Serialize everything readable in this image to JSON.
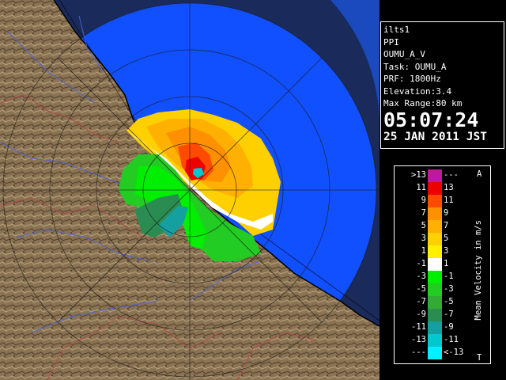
{
  "info": {
    "site": "ilts1",
    "scan": "PPI",
    "product": "OUMU_A_V",
    "task": "Task: OUMU_A",
    "prf": "PRF: 1800Hz",
    "elevation": "Elevation:3.4",
    "max_range": "Max Range:80 km",
    "time": "05:07:24",
    "date": "25 JAN 2011 JST"
  },
  "legend": {
    "title": "Mean Velocity in m/s",
    "top_letter": "A",
    "bottom_letter": "T",
    "rows": [
      {
        "lo": ">13",
        "hi": "---",
        "color": "#c0189a"
      },
      {
        "lo": "11",
        "hi": "13",
        "color": "#ee0000"
      },
      {
        "lo": "9",
        "hi": "11",
        "color": "#ff4a00"
      },
      {
        "lo": "7",
        "hi": "9",
        "color": "#ff9000"
      },
      {
        "lo": "5",
        "hi": "7",
        "color": "#ffb000"
      },
      {
        "lo": "3",
        "hi": "5",
        "color": "#ffd000"
      },
      {
        "lo": "1",
        "hi": "3",
        "color": "#fff000"
      },
      {
        "lo": "-1",
        "hi": "1",
        "color": "#ffffff"
      },
      {
        "lo": "-3",
        "hi": "-1",
        "color": "#00ee00"
      },
      {
        "lo": "-5",
        "hi": "-3",
        "color": "#22cc22"
      },
      {
        "lo": "-7",
        "hi": "-5",
        "color": "#33aa33"
      },
      {
        "lo": "-9",
        "hi": "-7",
        "color": "#2a8c50"
      },
      {
        "lo": "-11",
        "hi": "-9",
        "color": "#14a0a0"
      },
      {
        "lo": "-13",
        "hi": "-11",
        "color": "#00c8d0"
      },
      {
        "lo": "---",
        "hi": "<-13",
        "color": "#00f0ff"
      }
    ]
  },
  "colors": {
    "sea": "#1150ff",
    "sea_outer": "#2a72ff",
    "land": "#8a7352",
    "coast": "#000000",
    "rivers": "#4d64d8",
    "borders": "#b04646"
  }
}
